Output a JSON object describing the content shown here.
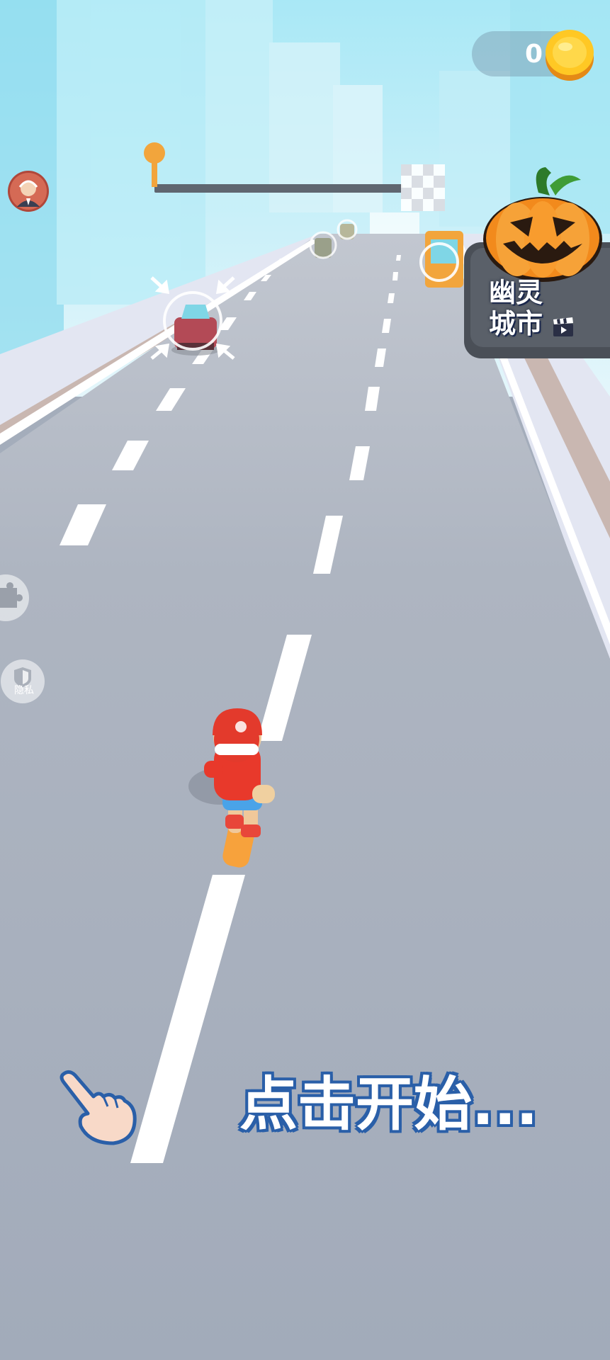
{
  "hud": {
    "coins": "0",
    "icons": {
      "coin": "coin-icon",
      "avatar": "avatar-icon",
      "start_pin": "progress-pin-icon",
      "finish": "checkered-flag-icon"
    }
  },
  "level": {
    "name_line1": "幽灵",
    "name_line2": "城市",
    "progress": 0,
    "icons": {
      "pumpkin": "pumpkin-icon",
      "video": "clapperboard-icon"
    }
  },
  "side_menu": {
    "privacy_label": "隐私",
    "icons": {
      "puzzle": "puzzle-icon",
      "shield": "shield-icon"
    }
  },
  "hint": {
    "text": "点击开始...",
    "icon": "tap-hand-icon"
  },
  "colors": {
    "road": "#a4adbb",
    "sky": "#cfeff8",
    "accent_orange": "#f2a53c",
    "hint_outline": "#2a5fa8",
    "player_red": "#e83a2b"
  }
}
